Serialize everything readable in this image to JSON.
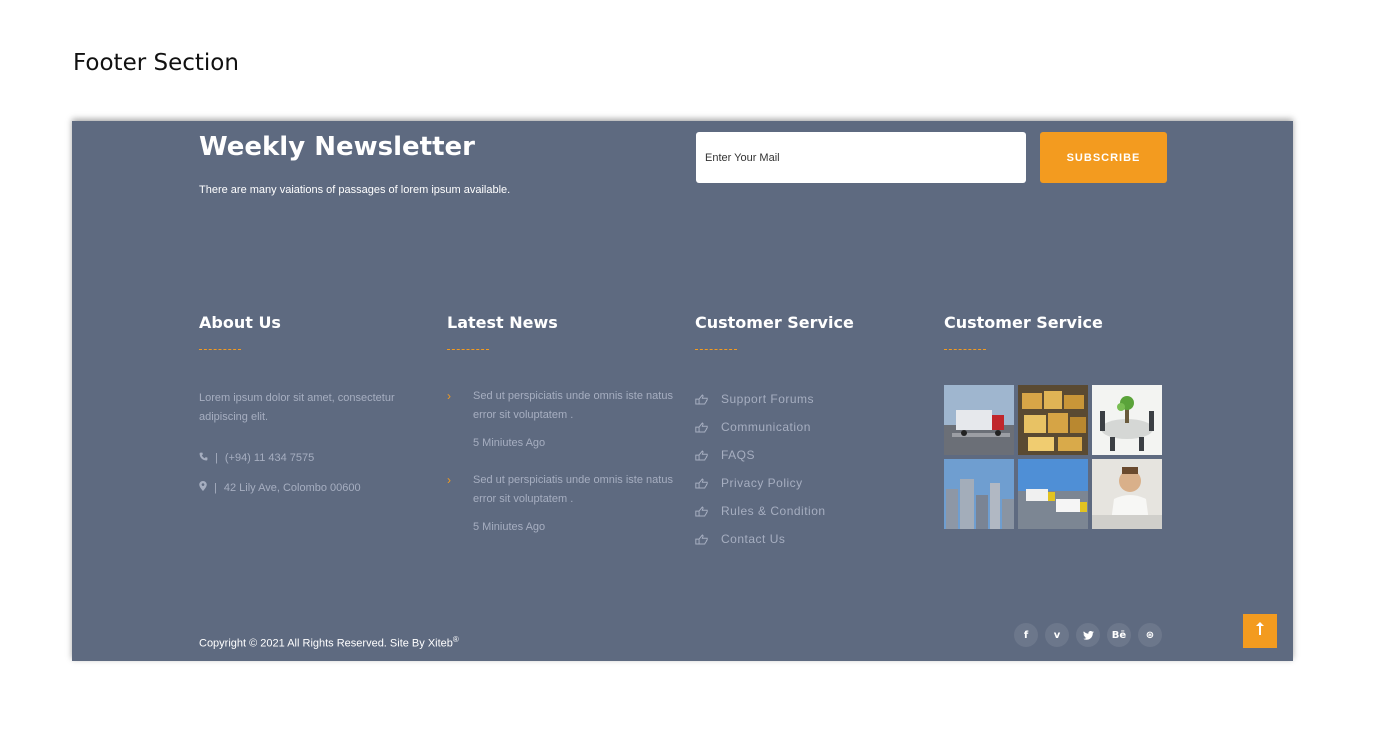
{
  "doc_heading": "Footer Section",
  "newsletter": {
    "title": "Weekly Newsletter",
    "subtitle": "There are many vaiations of passages of lorem ipsum available.",
    "input_placeholder": "Enter Your Mail",
    "subscribe_label": "SUBSCRIBE"
  },
  "columns": {
    "about": {
      "title": "About Us",
      "text": "Lorem ipsum dolor sit amet, consectetur adipiscing elit.",
      "phone_icon": "phone-icon",
      "phone_separator": "|",
      "phone": "(+94) 11 434 7575",
      "location_icon": "map-marker-icon",
      "location_separator": "|",
      "address": "42 Lily Ave, Colombo 00600"
    },
    "news": {
      "title": "Latest News",
      "bullet_icon": "chevron-right-icon",
      "items": [
        {
          "text": "Sed ut perspiciatis unde omnis iste natus error sit voluptatem .",
          "time": "5 Miniutes Ago"
        },
        {
          "text": "Sed ut perspiciatis unde omnis iste natus error sit voluptatem .",
          "time": "5 Miniutes Ago"
        }
      ]
    },
    "service": {
      "title": "Customer Service",
      "item_icon": "hand-pointing-icon",
      "items": [
        "Support Forums",
        "Communication",
        "FAQS",
        "Privacy Policy",
        "Rules & Condition",
        "Contact Us"
      ]
    },
    "gallery": {
      "title": "Customer Service",
      "images": [
        "truck-on-road",
        "warehouse-boxes",
        "meeting-table-plant",
        "city-buildings",
        "trucks-on-highway",
        "businessman-at-desk"
      ]
    }
  },
  "bottom": {
    "copyright": "Copyright © 2021 All Rights Reserved. Site By Xiteb",
    "copyright_mark": "®",
    "social": [
      {
        "icon": "facebook-icon",
        "glyph": "f"
      },
      {
        "icon": "vimeo-icon",
        "glyph": "v"
      },
      {
        "icon": "twitter-icon",
        "glyph": "🐦"
      },
      {
        "icon": "behance-icon",
        "glyph": "Bē"
      },
      {
        "icon": "dribbble-icon",
        "glyph": "⊛"
      }
    ],
    "back_to_top_icon": "arrow-up-icon"
  },
  "colors": {
    "footer_bg": "#5e6a80",
    "accent": "#f39b1f",
    "muted_text": "#a6aec0"
  }
}
